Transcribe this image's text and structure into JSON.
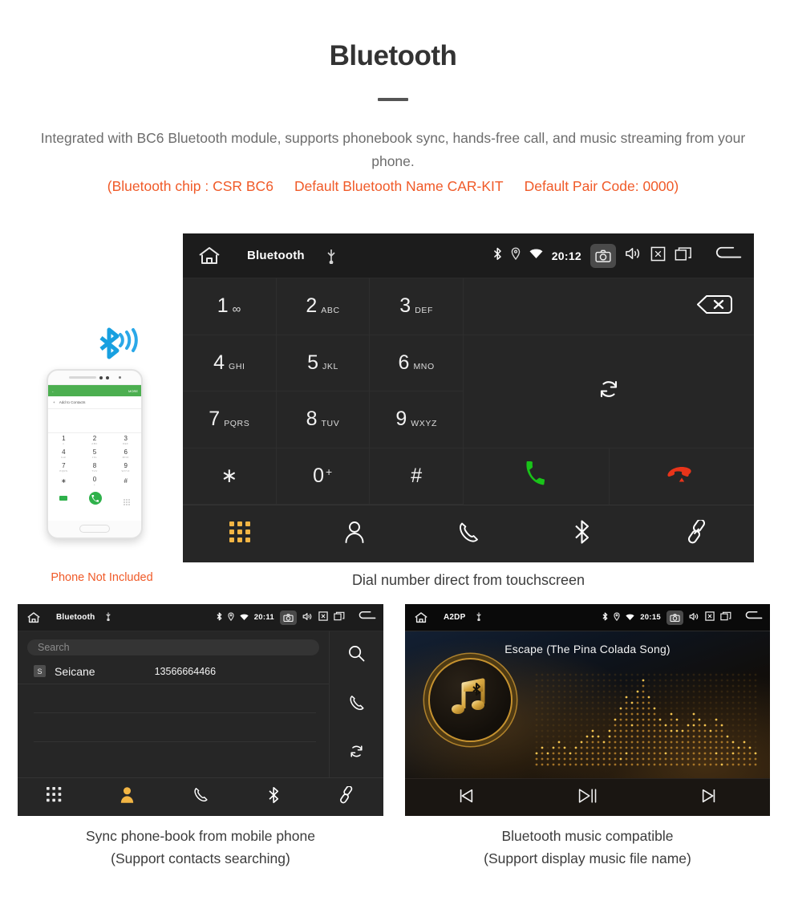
{
  "header": {
    "title": "Bluetooth",
    "intro": "Integrated with BC6 Bluetooth module, supports phonebook sync, hands-free call, and music streaming from your phone.",
    "spec_chip": "(Bluetooth chip : CSR BC6",
    "spec_name": "Default Bluetooth Name CAR-KIT",
    "spec_pair": "Default Pair Code: 0000)",
    "accent_color": "#f05a28",
    "text_color": "#6d6d6d"
  },
  "phone_mockup": {
    "appbar_back": "←",
    "appbar_more": "MORE",
    "add_to_contacts": "Add to Contacts",
    "plus": "+",
    "keys": [
      {
        "n": "1",
        "l": "∞"
      },
      {
        "n": "2",
        "l": "ABC"
      },
      {
        "n": "3",
        "l": "DEF"
      },
      {
        "n": "4",
        "l": "GHI"
      },
      {
        "n": "5",
        "l": "JKL"
      },
      {
        "n": "6",
        "l": "MNO"
      },
      {
        "n": "7",
        "l": "PQRS"
      },
      {
        "n": "8",
        "l": "TUV"
      },
      {
        "n": "9",
        "l": "WXYZ"
      },
      {
        "n": "∗",
        "l": ""
      },
      {
        "n": "0",
        "l": "+"
      },
      {
        "n": "#",
        "l": ""
      }
    ],
    "caption": "Phone Not Included"
  },
  "dialer": {
    "statusbar": {
      "title": "Bluetooth",
      "time": "20:12",
      "home_icon": "home-icon",
      "usb_icon": "usb-icon",
      "bluetooth_icon": "bluetooth-icon",
      "location_icon": "location-icon",
      "wifi_icon": "wifi-icon",
      "camera_icon": "camera-icon",
      "volume_icon": "volume-icon",
      "close_icon": "close-box-icon",
      "recents_icon": "recents-icon",
      "back_icon": "back-icon"
    },
    "keys": [
      {
        "num": "1",
        "sub": "∞",
        "type": "voicemail"
      },
      {
        "num": "2",
        "sub": "ABC",
        "type": "letters"
      },
      {
        "num": "3",
        "sub": "DEF",
        "type": "letters"
      },
      {
        "num": "4",
        "sub": "GHI",
        "type": "letters"
      },
      {
        "num": "5",
        "sub": "JKL",
        "type": "letters"
      },
      {
        "num": "6",
        "sub": "MNO",
        "type": "letters"
      },
      {
        "num": "7",
        "sub": "PQRS",
        "type": "letters"
      },
      {
        "num": "8",
        "sub": "TUV",
        "type": "letters"
      },
      {
        "num": "9",
        "sub": "WXYZ",
        "type": "letters"
      },
      {
        "num": "∗",
        "sub": "",
        "type": "plain"
      },
      {
        "num": "0",
        "sub": "+",
        "type": "plus"
      },
      {
        "num": "#",
        "sub": "",
        "type": "plain"
      }
    ],
    "actions": {
      "backspace": "backspace-icon",
      "sync": "sync-icon",
      "call": "call-icon",
      "hangup": "hangup-icon",
      "call_color": "#19c319",
      "hangup_color": "#e8341a"
    },
    "tabs": [
      {
        "name": "dialpad",
        "icon": "dialpad-icon",
        "active": true
      },
      {
        "name": "contacts",
        "icon": "person-icon",
        "active": false
      },
      {
        "name": "call-log",
        "icon": "phone-icon",
        "active": false
      },
      {
        "name": "bluetooth",
        "icon": "bluetooth-icon",
        "active": false
      },
      {
        "name": "link",
        "icon": "link-icon",
        "active": false
      }
    ],
    "active_color": "#f2b544",
    "caption": "Dial number direct from touchscreen"
  },
  "phonebook": {
    "statusbar": {
      "title": "Bluetooth",
      "time": "20:11"
    },
    "search_placeholder": "Search",
    "contacts": [
      {
        "initial": "S",
        "name": "Seicane",
        "number": "13566664466"
      }
    ],
    "side_actions": [
      {
        "name": "search",
        "icon": "search-icon"
      },
      {
        "name": "call",
        "icon": "phone-icon"
      },
      {
        "name": "sync",
        "icon": "sync-icon"
      }
    ],
    "tabs": [
      {
        "name": "dialpad",
        "icon": "dialpad-icon",
        "active": false
      },
      {
        "name": "contacts",
        "icon": "person-icon",
        "active": true
      },
      {
        "name": "call-log",
        "icon": "phone-icon",
        "active": false
      },
      {
        "name": "bluetooth",
        "icon": "bluetooth-icon",
        "active": false
      },
      {
        "name": "link",
        "icon": "link-icon",
        "active": false
      }
    ],
    "caption_line1": "Sync phone-book from mobile phone",
    "caption_line2": "(Support contacts searching)"
  },
  "music": {
    "statusbar": {
      "title": "A2DP",
      "time": "20:15"
    },
    "song_title": "Escape (The Pina Colada Song)",
    "album_icon": "music-note-bluetooth-icon",
    "controls": [
      {
        "name": "previous",
        "icon": "skip-previous-icon"
      },
      {
        "name": "play-pause",
        "icon": "play-pause-icon"
      },
      {
        "name": "next",
        "icon": "skip-next-icon"
      }
    ],
    "accent_color": "#c6922f",
    "caption_line1": "Bluetooth music compatible",
    "caption_line2": "(Support display music file name)"
  }
}
